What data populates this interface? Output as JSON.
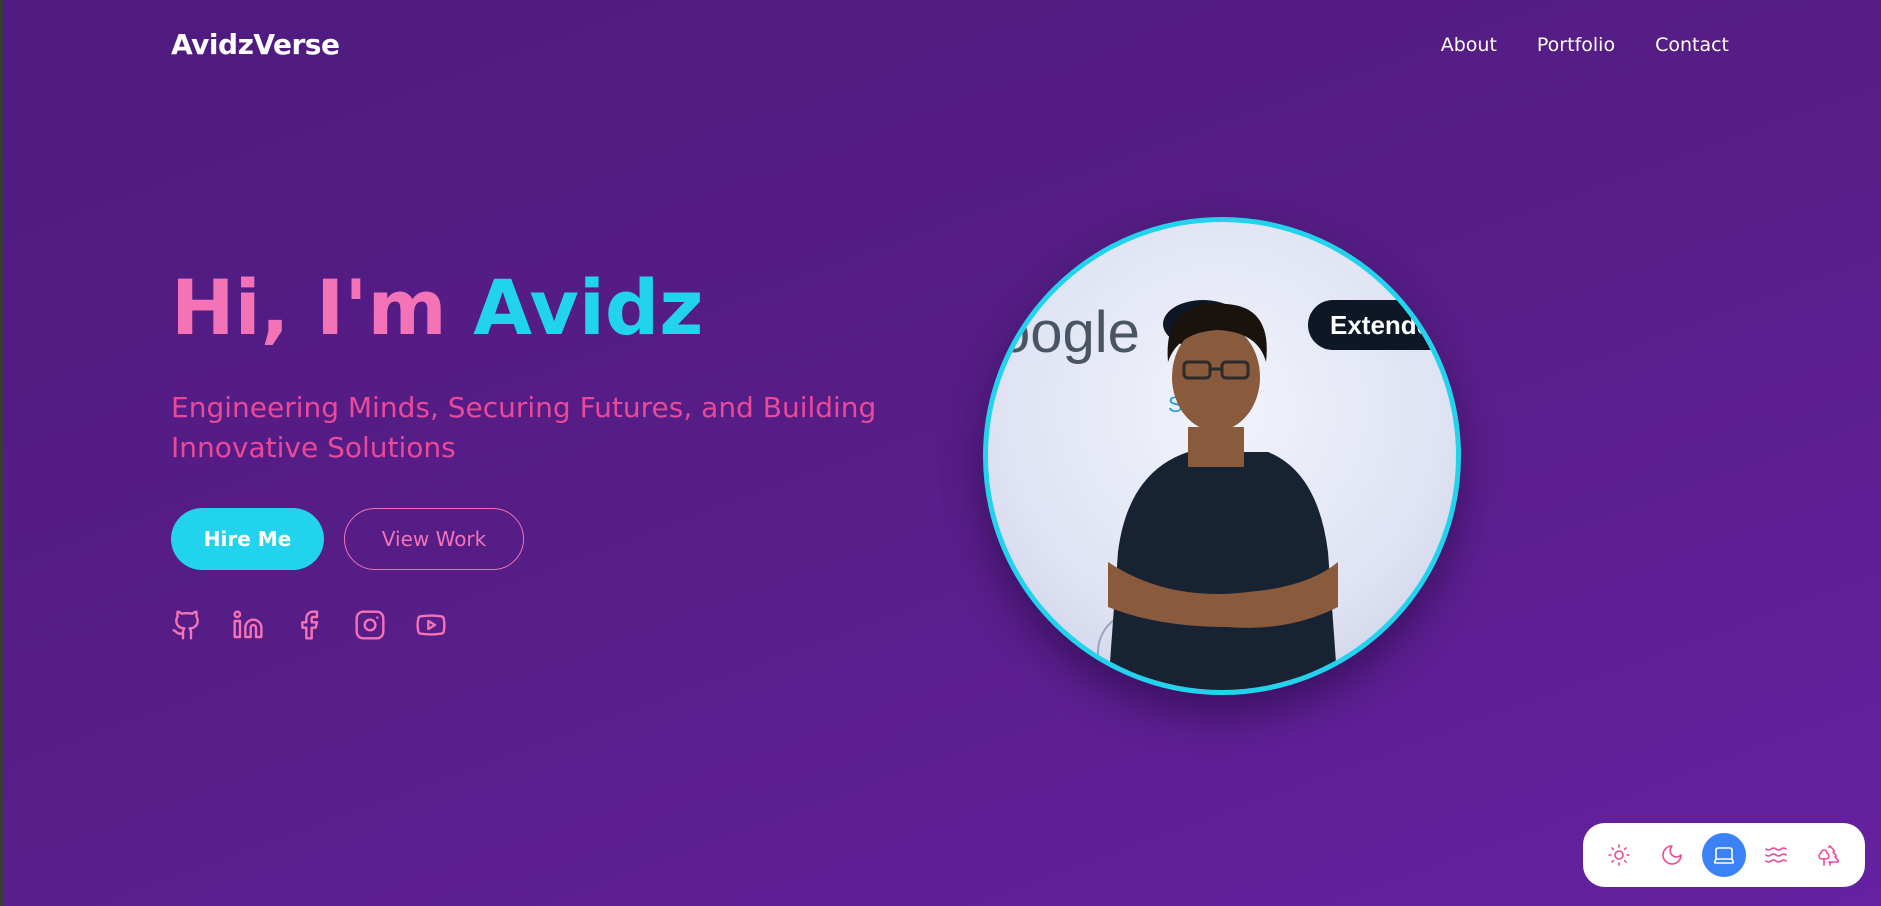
{
  "brand": "AvidzVerse",
  "nav": {
    "items": [
      "About",
      "Portfolio",
      "Contact"
    ]
  },
  "hero": {
    "greeting": "Hi, I'm",
    "name": "Avidz",
    "tagline": "Engineering Minds, Securing Futures, and Building Innovative Solutions",
    "primary_button": "Hire Me",
    "secondary_button": "View Work"
  },
  "photo": {
    "backdrop_text_left": "oogle",
    "backdrop_text_right": "Extended",
    "backdrop_text_sub": "Sri  a"
  },
  "social": [
    "github-icon",
    "linkedin-icon",
    "facebook-icon",
    "instagram-icon",
    "youtube-icon"
  ],
  "theme_switcher": {
    "options": [
      "sun-icon",
      "moon-icon",
      "laptop-icon",
      "waves-icon",
      "trees-icon"
    ],
    "active": "laptop-icon"
  },
  "colors": {
    "background": "#561d86",
    "accent_cyan": "#22d3ee",
    "accent_pink": "#f472b6",
    "active_blue": "#3b82f6"
  }
}
